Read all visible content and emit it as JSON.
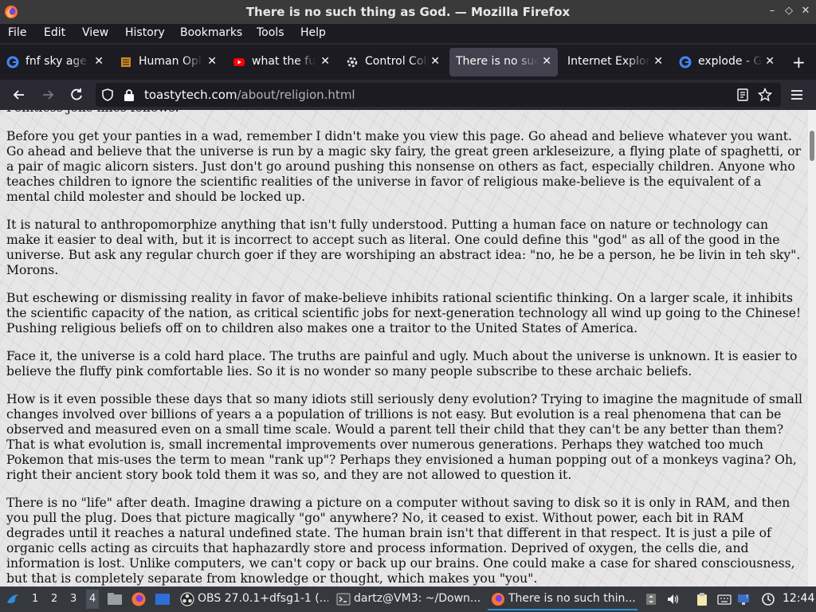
{
  "window": {
    "title": "There is no such thing as God. — Mozilla Firefox",
    "controls": [
      "minimize",
      "maximize",
      "close"
    ]
  },
  "menu": [
    "File",
    "Edit",
    "View",
    "History",
    "Bookmarks",
    "Tools",
    "Help"
  ],
  "tabs": [
    {
      "label": "fnf sky age -",
      "icon": "google-icon"
    },
    {
      "label": "Human Oph",
      "icon": "site-icon"
    },
    {
      "label": "what the fuc",
      "icon": "youtube-icon"
    },
    {
      "label": "Control Colla",
      "icon": "gear-icon"
    },
    {
      "label": "There is no suc",
      "icon": "",
      "active": true
    },
    {
      "label": "Internet Explore",
      "icon": ""
    },
    {
      "label": "explode - Go",
      "icon": "google-icon"
    }
  ],
  "url": {
    "host": "toastytech.com",
    "path": "/about/religion.html"
  },
  "content": {
    "paragraphs": [
      "Before you get your panties in a wad, remember I didn't make you view this page. Go ahead and believe whatever you want. Go ahead and believe that the universe is run by a magic sky fairy, the great green arkleseizure, a flying plate of spaghetti, or a pair of magic alicorn sisters. Just don't go around pushing this nonsense on others as fact, especially children. Anyone who teaches children to ignore the scientific realities of the universe in favor of religious make-believe is the equivalent of a mental child molester and should be locked up.",
      "It is natural to anthropomorphize anything that isn't fully understood. Putting a human face on nature or technology can make it easier to deal with, but it is incorrect to accept such as literal. One could define this \"god\" as all of the good in the universe. But ask any regular church goer if they are worshiping an abstract idea: \"no, he be a person, he be livin in teh sky\". Morons.",
      "But eschewing or dismissing reality in favor of make-believe inhibits rational scientific thinking. On a larger scale, it inhibits the scientific capacity of the nation, as critical scientific jobs for next-generation technology all wind up going to the Chinese! Pushing religious beliefs off on to children also makes one a traitor to the United States of America.",
      "Face it, the universe is a cold hard place. The truths are painful and ugly. Much about the universe is unknown. It is easier to believe the fluffy pink comfortable lies. So it is no wonder so many people subscribe to these archaic beliefs.",
      "How is it even possible these days that so many idiots still seriously deny evolution? Trying to imagine the magnitude of small changes involved over billions of years a a population of trillions is not easy. But evolution is a real phenomena that can be observed and measured even on a small time scale. Would a parent tell their child that they can't be any better than them? That is what evolution is, small incremental improvements over numerous generations. Perhaps they watched too much Pokemon that mis-uses the term to mean \"rank up\"? Perhaps they envisioned a human popping out of a monkeys vagina? Oh, right their ancient story book told them it was so, and they are not allowed to question it.",
      "There is no \"life\" after death. Imagine drawing a picture on a computer without saving to disk so it is only in RAM, and then you pull the plug. Does that picture magically \"go\" anywhere? No, it ceased to exist. Without power, each bit in RAM degrades until it reaches a natural undefined state. The human brain isn't that different in that respect. It is just a pile of organic cells acting as circuits that haphazardly store and process information. Deprived of oxygen, the cells die, and information is lost. Unlike computers, we can't copy or back up our brains. One could make a case for shared consciousness, but that is completely separate from knowledge or thought, which makes you \"you\"."
    ]
  },
  "taskbar": {
    "workspaces": [
      "1",
      "2",
      "3",
      "4"
    ],
    "current_workspace": "4",
    "tasks": [
      {
        "label": "OBS 27.0.1+dfsg1-1 (...",
        "icon": "obs-icon"
      },
      {
        "label": "dartz@VM3: ~/Down...",
        "icon": "terminal-icon"
      },
      {
        "label": "There is no such thin...",
        "icon": "firefox-icon",
        "active": true
      }
    ],
    "clock": "12:44"
  }
}
